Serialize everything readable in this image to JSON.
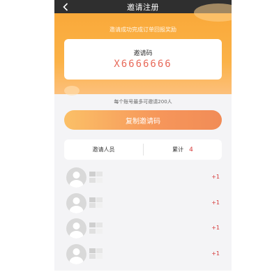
{
  "header": {
    "title": "邀请注册",
    "back_icon": "chevron-left-icon"
  },
  "hero": {
    "subtitle": "邀请成功完成订单回报奖励"
  },
  "invite_card": {
    "label": "邀请码",
    "code": "X6666666"
  },
  "limit_text": "每个账号最多可邀请200人",
  "copy_button": {
    "label": "复制邀请码"
  },
  "stats": {
    "invitees_label": "邀请人员",
    "total_label": "累计",
    "total_count": "4"
  },
  "invitees": [
    {
      "reward": "+1"
    },
    {
      "reward": "+1"
    },
    {
      "reward": "+1"
    },
    {
      "reward": "+1"
    }
  ],
  "colors": {
    "accent_orange": "#f9a93a",
    "code_red": "#e86a5a",
    "count_red": "#d63a3a",
    "nav_dark": "#2f2f2f"
  }
}
